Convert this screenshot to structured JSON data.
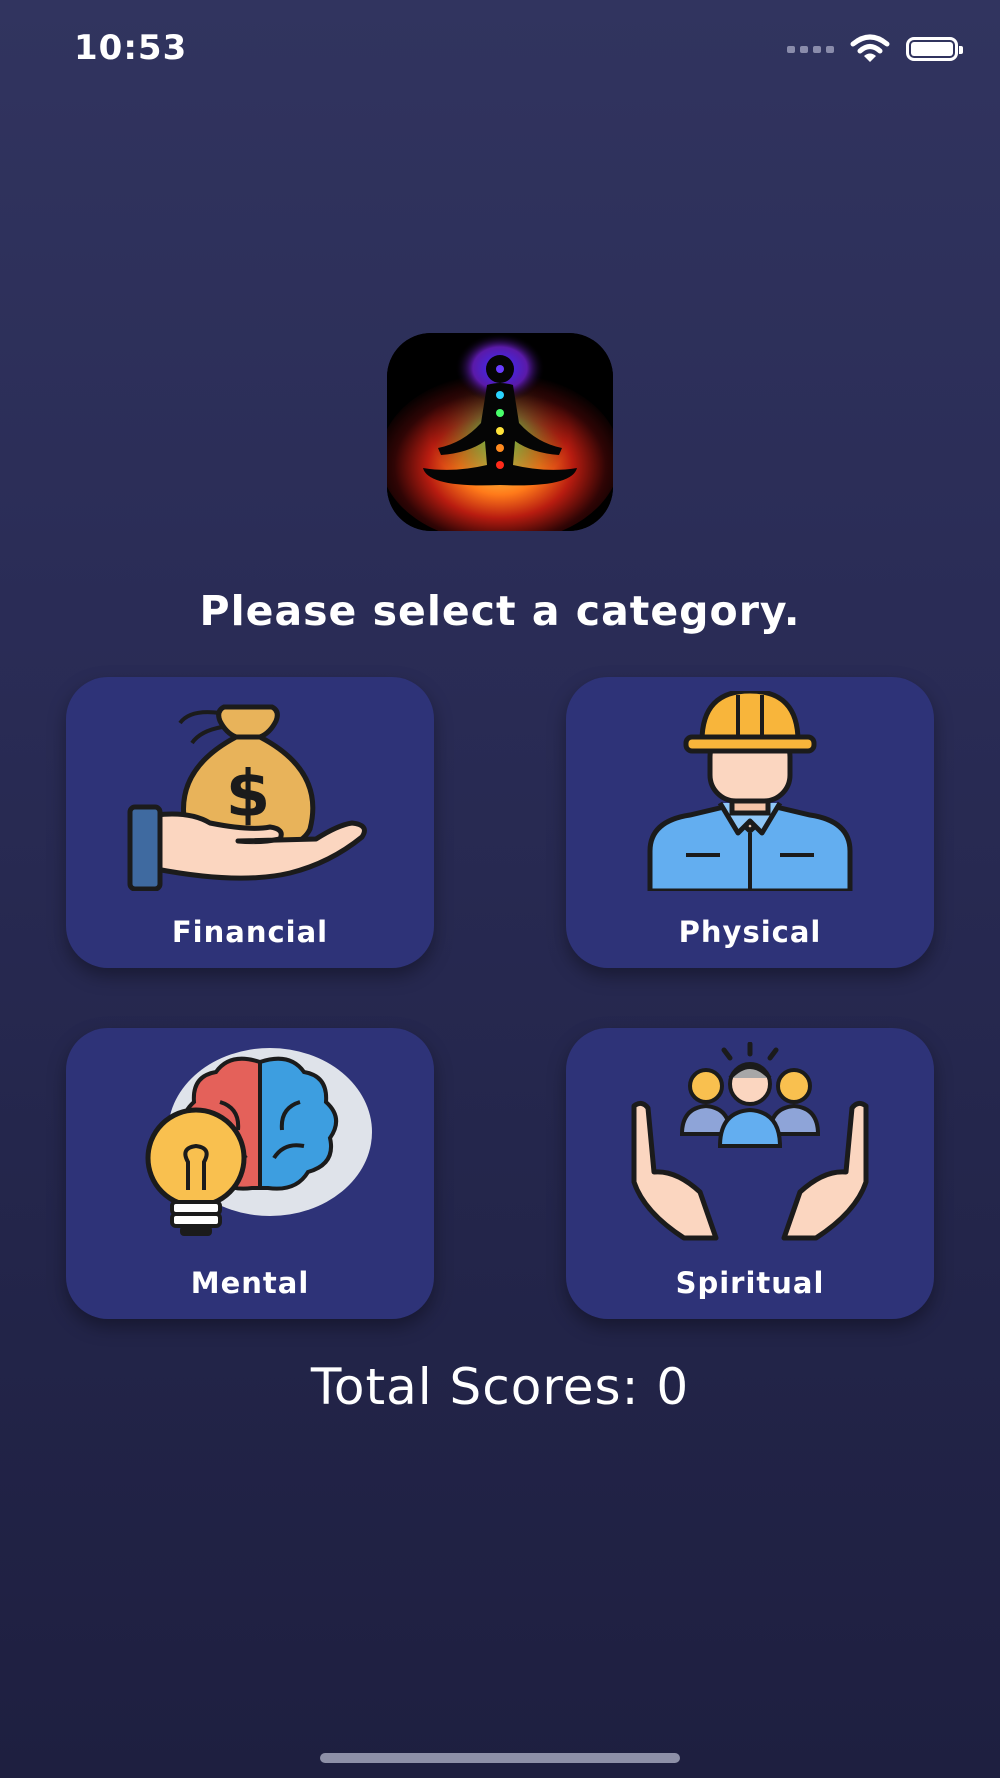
{
  "status_bar": {
    "time": "10:53",
    "icons": [
      "cellular-signal-icon",
      "wifi-icon",
      "battery-icon"
    ]
  },
  "logo": {
    "icon": "meditation-chakra-icon"
  },
  "prompt": "Please select a category.",
  "categories": [
    {
      "label": "Financial",
      "icon": "money-bag-hand-icon"
    },
    {
      "label": "Physical",
      "icon": "worker-hardhat-icon"
    },
    {
      "label": "Mental",
      "icon": "brain-lightbulb-icon"
    },
    {
      "label": "Spiritual",
      "icon": "hands-people-icon"
    }
  ],
  "total": {
    "label": "Total Scores:",
    "value": "0"
  },
  "colors": {
    "card_bg": "#2e3378",
    "background_top": "#31345f",
    "background_bottom": "#1e1f40",
    "text": "#ffffff"
  }
}
